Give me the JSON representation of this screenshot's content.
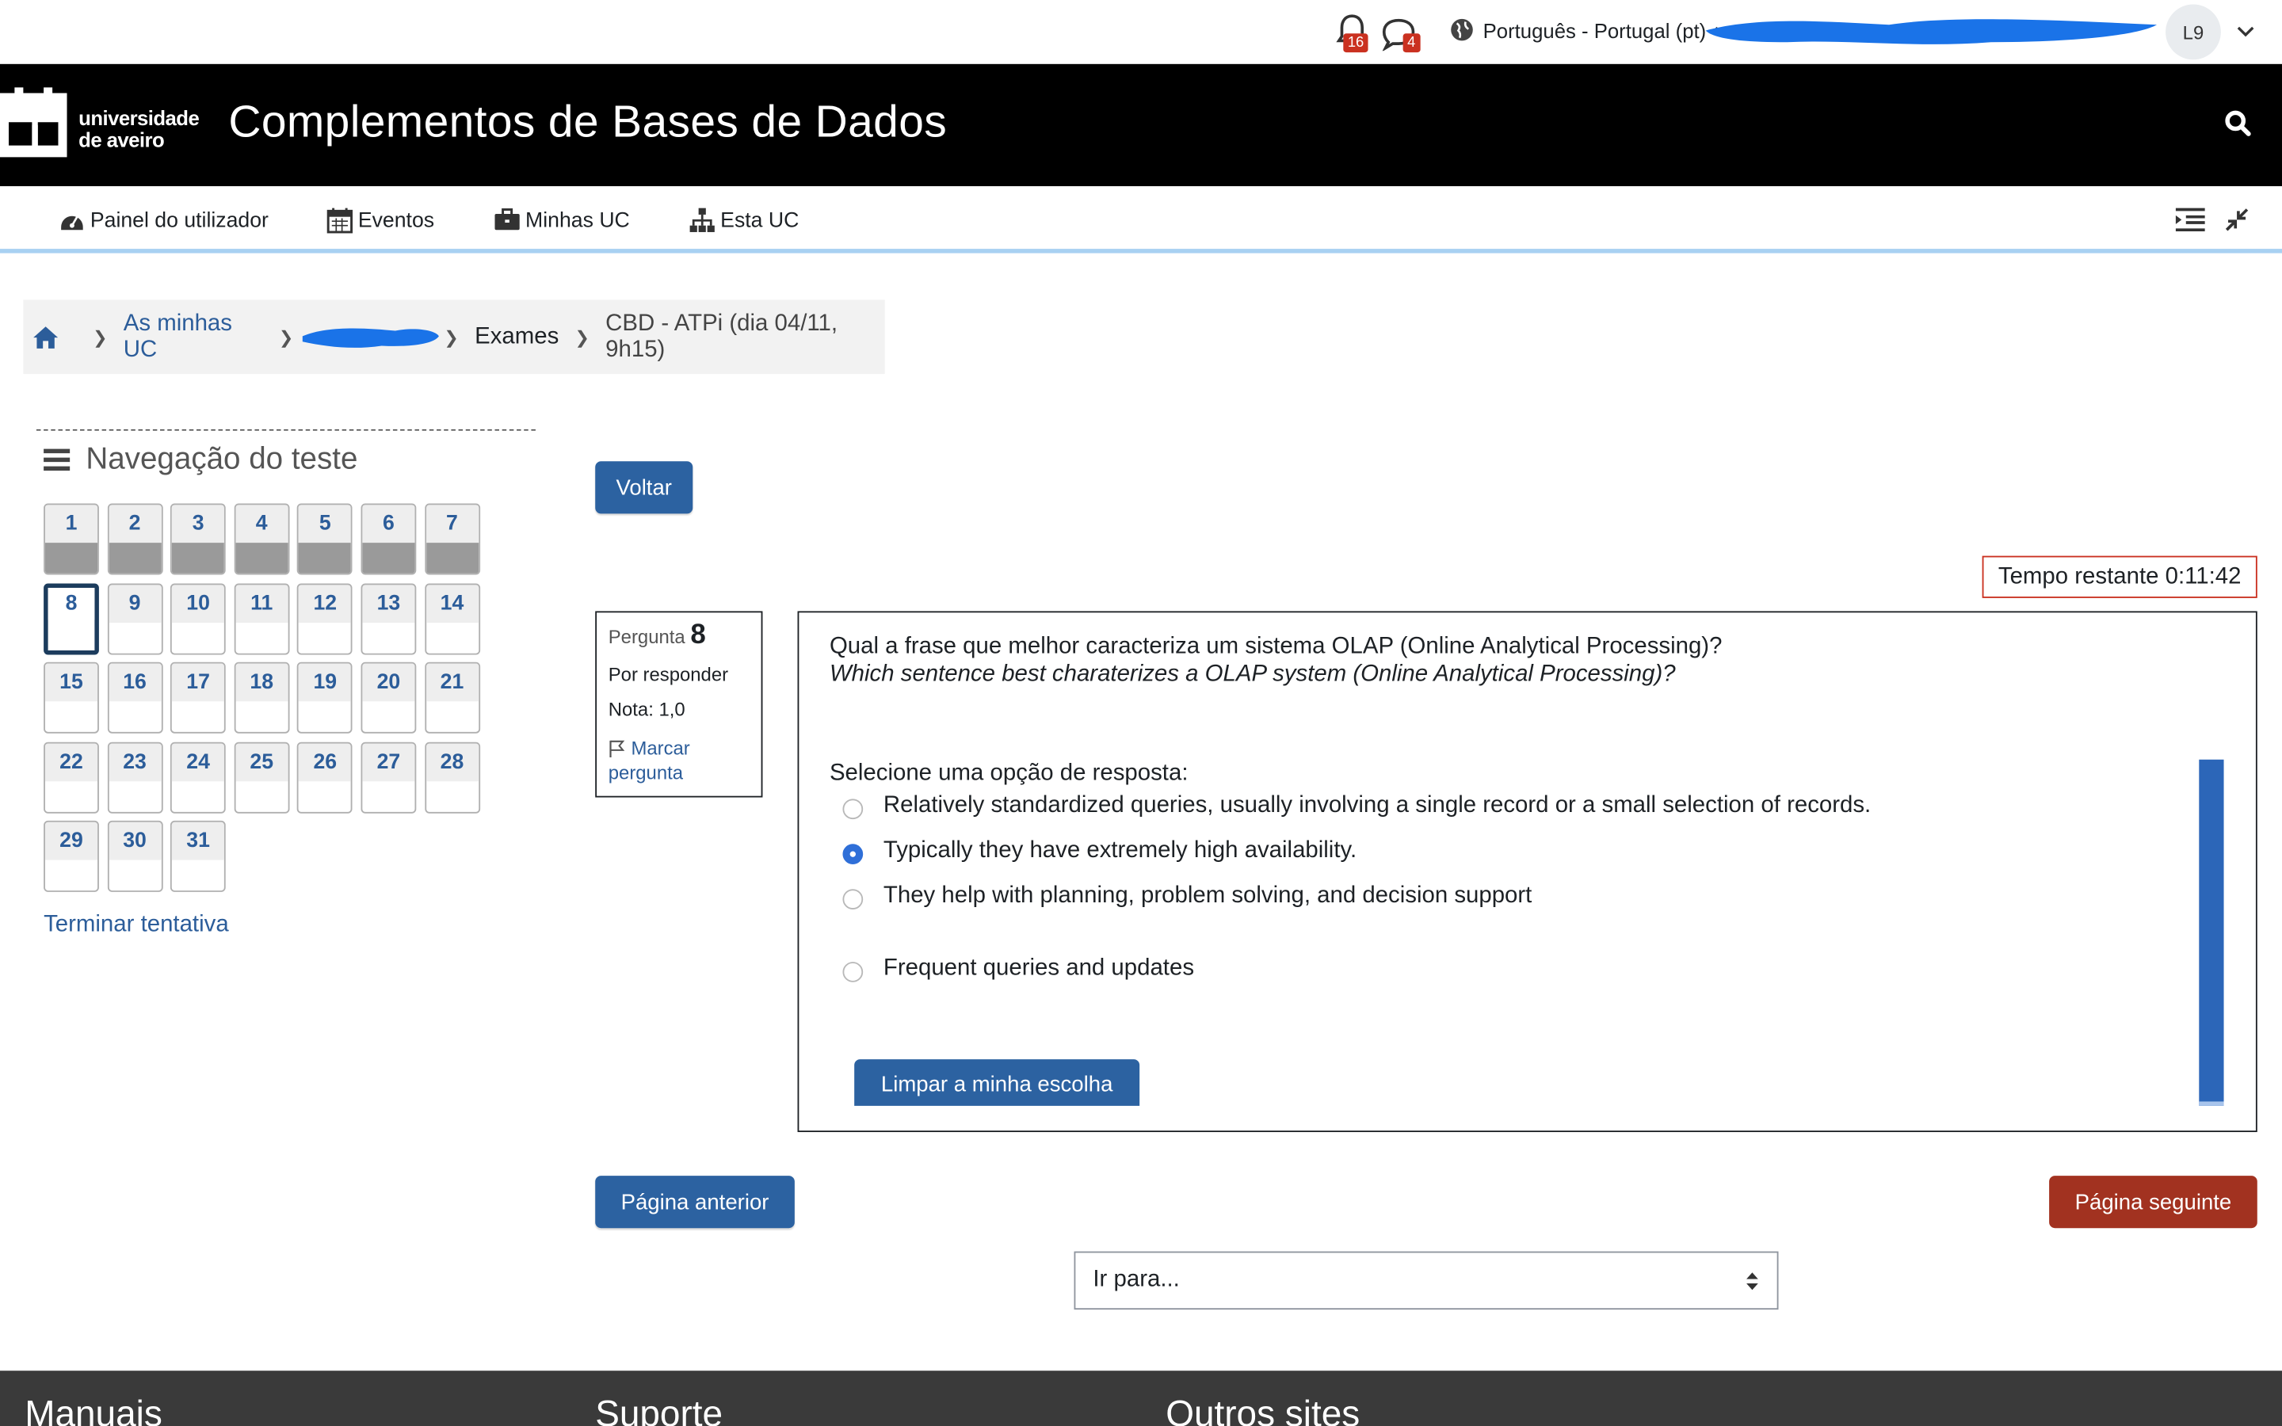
{
  "topbar": {
    "notifications_count": "16",
    "messages_count": "4",
    "language": "Português - Portugal (pt)",
    "avatar_initials": "L9"
  },
  "header": {
    "logo_line1": "universidade",
    "logo_line2": "de aveiro",
    "course_title": "Complementos de Bases de Dados"
  },
  "nav": {
    "items": [
      {
        "label": "Painel do utilizador",
        "icon": "dashboard-icon"
      },
      {
        "label": "Eventos",
        "icon": "calendar-icon"
      },
      {
        "label": "Minhas UC",
        "icon": "briefcase-icon"
      },
      {
        "label": "Esta UC",
        "icon": "sitemap-icon"
      }
    ]
  },
  "breadcrumb": {
    "my_courses": "As minhas UC",
    "exams": "Exames",
    "current": "CBD - ATPi (dia 04/11, 9h15)"
  },
  "quiz_nav": {
    "title": "Navegação do teste",
    "questions": [
      "1",
      "2",
      "3",
      "4",
      "5",
      "6",
      "7",
      "8",
      "9",
      "10",
      "11",
      "12",
      "13",
      "14",
      "15",
      "16",
      "17",
      "18",
      "19",
      "20",
      "21",
      "22",
      "23",
      "24",
      "25",
      "26",
      "27",
      "28",
      "29",
      "30",
      "31"
    ],
    "answered": [
      "1",
      "2",
      "3",
      "4",
      "5",
      "6",
      "7"
    ],
    "current": "8",
    "finish_label": "Terminar tentativa"
  },
  "main": {
    "back_label": "Voltar",
    "timer_text": "Tempo restante 0:11:42",
    "question_info": {
      "label": "Pergunta",
      "number": "8",
      "state": "Por responder",
      "grade": "Nota: 1,0",
      "flag_label": "Marcar pergunta"
    },
    "question": {
      "text_pt": "Qual a frase que melhor caracteriza um sistema OLAP (Online Analytical Processing)?",
      "text_en": "Which sentence best charaterizes a OLAP system (Online Analytical Processing)?",
      "prompt": "Selecione uma opção de resposta:",
      "options": [
        {
          "label": "Relatively standardized queries, usually involving a single record or a small selection of records.",
          "checked": false
        },
        {
          "label": "Typically they have extremely high availability.",
          "checked": true
        },
        {
          "label": "They help with planning, problem solving, and decision support",
          "checked": false
        },
        {
          "label": "Frequent queries and updates",
          "checked": false
        }
      ],
      "clear_label": "Limpar a minha escolha"
    },
    "prev_label": "Página anterior",
    "next_label": "Página seguinte",
    "goto_placeholder": "Ir para..."
  },
  "footer": {
    "col1": "Manuais",
    "col2": "Suporte",
    "col3": "Outros sites"
  },
  "colors": {
    "header_bg": "#000000",
    "link": "#2c5d9a",
    "primary_button": "#2c62a1",
    "next_button": "#a23220",
    "badge": "#ca3120",
    "redaction": "#1a73e8"
  }
}
